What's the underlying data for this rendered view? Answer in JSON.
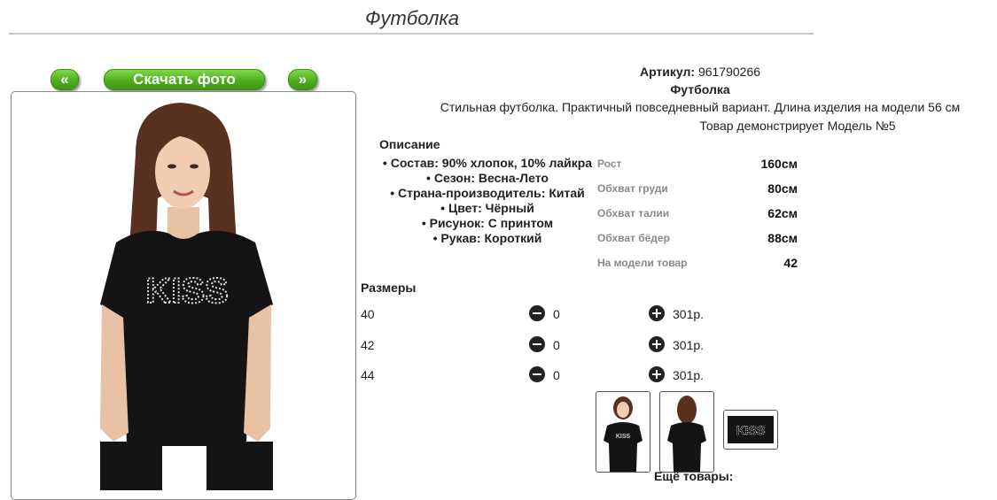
{
  "page": {
    "title": "Футболка"
  },
  "gallery": {
    "prev_label": "«",
    "download_label": "Скачать фото",
    "next_label": "»"
  },
  "product": {
    "article_label": "Артикул:",
    "article_value": "961790266",
    "name": "Футболка",
    "description": "Стильная футболка. Практичный повседневный вариант. Длина изделия на модели 56 см",
    "model_note": "Товар демонстрирует Модель №5"
  },
  "specs": {
    "heading": "Описание",
    "items": [
      "Состав: 90% хлопок, 10% лайкра",
      "Сезон: Весна-Лето",
      "Страна-производитель: Китай",
      "Цвет: Чёрный",
      "Рисунок: С принтом",
      "Рукав: Короткий"
    ]
  },
  "measurements": [
    {
      "label": "Рост",
      "value": "160см"
    },
    {
      "label": "Обхват груди",
      "value": "80см"
    },
    {
      "label": "Обхват талии",
      "value": "62см"
    },
    {
      "label": "Обхват бёдер",
      "value": "88см"
    },
    {
      "label": "На модели товар",
      "value": "42"
    }
  ],
  "sizes": {
    "heading": "Размеры",
    "rows": [
      {
        "size": "40",
        "qty": "0",
        "price": "301р."
      },
      {
        "size": "42",
        "qty": "0",
        "price": "301р."
      },
      {
        "size": "44",
        "qty": "0",
        "price": "301р."
      }
    ]
  },
  "print_text": "KISS",
  "more_goods": "Ещё товары:",
  "colors": {
    "accent_green": "#4fae1e",
    "shirt": "#141414",
    "hair": "#5a3020"
  }
}
